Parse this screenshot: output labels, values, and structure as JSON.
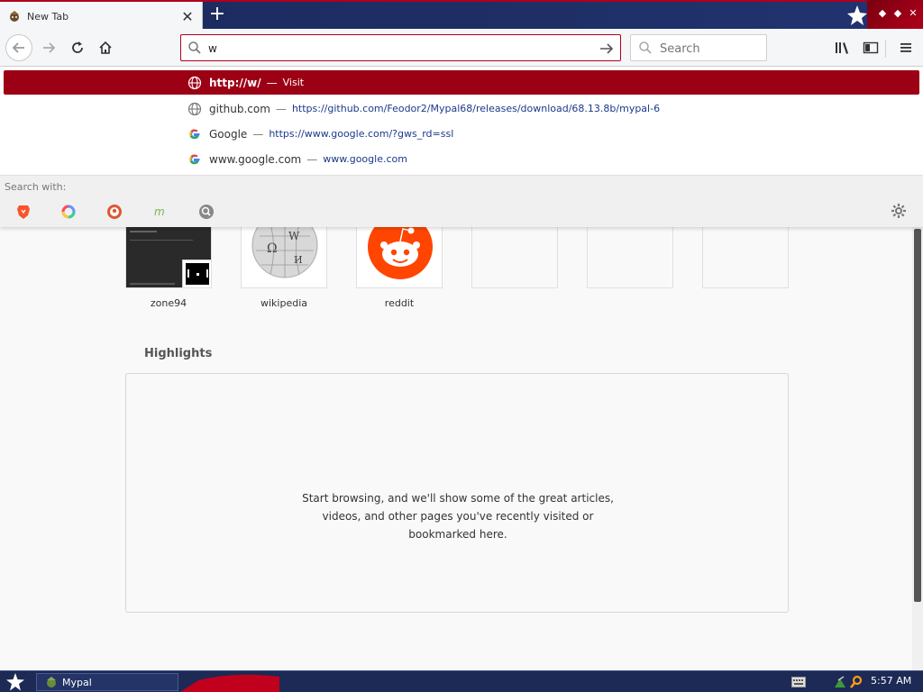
{
  "browser": {
    "tab": {
      "title": "New Tab",
      "close_icon": "close-icon"
    },
    "newtab_icon": "plus-icon"
  },
  "navbar": {
    "url_value": "w",
    "search_placeholder": "Search"
  },
  "autocomplete": {
    "rows": [
      {
        "icon": "globe-icon",
        "title": "http://w/",
        "sep": "—",
        "url": "Visit",
        "selected": true
      },
      {
        "icon": "globe-icon",
        "title": "github.com",
        "sep": "—",
        "url": "https://github.com/Feodor2/Mypal68/releases/download/68.13.8b/mypal-6",
        "selected": false
      },
      {
        "icon": "google-icon",
        "title": "Google",
        "sep": "—",
        "url": "https://www.google.com/?gws_rd=ssl",
        "selected": false
      },
      {
        "icon": "google-icon",
        "title": "www.google.com",
        "sep": "—",
        "url": "www.google.com",
        "selected": false
      }
    ],
    "search_with_label": "Search with:",
    "engines": [
      "brave-icon",
      "qwant-icon",
      "duckduckgo-icon",
      "mojeek-icon",
      "searx-icon"
    ]
  },
  "topsites": [
    {
      "name": "zone94"
    },
    {
      "name": "wikipedia"
    },
    {
      "name": "reddit"
    },
    {
      "name": ""
    },
    {
      "name": ""
    },
    {
      "name": ""
    }
  ],
  "highlights": {
    "title": "Highlights",
    "message_line1": "Start browsing, and we'll show some of the great articles,",
    "message_line2": "videos, and other pages you've recently visited or",
    "message_line3": "bookmarked here."
  },
  "taskbar": {
    "app_label": "Mypal",
    "clock": "5:57 AM"
  },
  "colors": {
    "accent": "#9c0015",
    "tabstrip": "#1f2f66",
    "taskbar": "#1c2a55"
  }
}
